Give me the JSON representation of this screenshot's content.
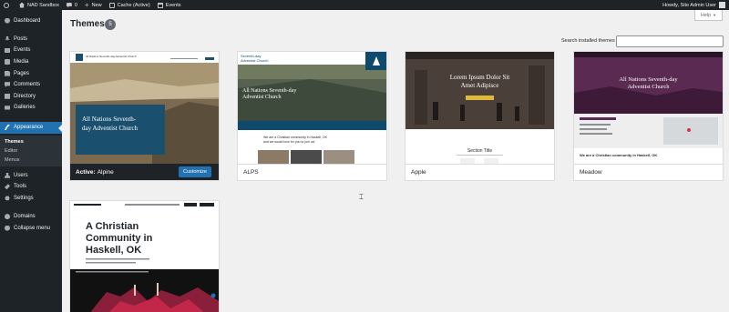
{
  "adminbar": {
    "site_name": "NAD Sandbox",
    "comments_count": "0",
    "new_label": "New",
    "cache_label": "Cache (Active)",
    "events_label": "Events",
    "howdy": "Howdy, Site Admin User"
  },
  "sidebar": {
    "items": [
      {
        "label": "Dashboard",
        "icon": "dashboard-icon"
      },
      {
        "label": "Posts",
        "icon": "pin-icon"
      },
      {
        "label": "Events",
        "icon": "calendar-icon"
      },
      {
        "label": "Media",
        "icon": "media-icon"
      },
      {
        "label": "Pages",
        "icon": "page-icon"
      },
      {
        "label": "Comments",
        "icon": "comment-icon"
      },
      {
        "label": "Directory",
        "icon": "directory-icon"
      },
      {
        "label": "Galleries",
        "icon": "gallery-icon"
      },
      {
        "label": "Appearance",
        "icon": "paintbrush-icon"
      },
      {
        "label": "Users",
        "icon": "users-icon"
      },
      {
        "label": "Tools",
        "icon": "wrench-icon"
      },
      {
        "label": "Settings",
        "icon": "gear-icon"
      },
      {
        "label": "Domains",
        "icon": "globe-icon"
      },
      {
        "label": "Collapse menu",
        "icon": "collapse-icon"
      }
    ],
    "submenu": [
      "Themes",
      "Editor",
      "Menus"
    ]
  },
  "page": {
    "title": "Themes",
    "count": "5",
    "help_label": "Help",
    "search_label": "Search installed themes",
    "search_value": ""
  },
  "themes": [
    {
      "name": "Alpine",
      "active_prefix": "Active:",
      "customize_label": "Customize",
      "shot": {
        "header_title": "All Nations Seventh-day Adventist Church",
        "hero_line1": "All Nations Seventh-",
        "hero_line2": "day Adventist Church"
      }
    },
    {
      "name": "ALPS",
      "shot": {
        "header_title_1": "Seventh-day",
        "header_title_2": "Adventist Church",
        "hero_line1": "All Nations Seventh-day",
        "hero_line2": "Adventist Church",
        "body_line1": "We are a Christian community in Haskell, OK",
        "body_line2": "and we would love for you to join us!"
      }
    },
    {
      "name": "Apple",
      "shot": {
        "hero_line1": "Lorem Ipsum Dolor Sit",
        "hero_line2": "Amet Adipisce",
        "section_title": "Section Title"
      }
    },
    {
      "name": "Meadow",
      "shot": {
        "hero_line1": "All Nations Seventh-day",
        "hero_line2": "Adventist Church",
        "body_line1": "We are a Christian community in Haskell, OK"
      }
    },
    {
      "name": "",
      "shot": {
        "hero_line1": "A Christian",
        "hero_line2": "Community in",
        "hero_line3": "Haskell, OK"
      }
    }
  ],
  "colors": {
    "admin_dark": "#1d2327",
    "accent": "#2271b1",
    "alpine_teal": "#1a4f6e",
    "alps_blue": "#0e4a6b",
    "meadow_purple": "#5b2a52"
  }
}
